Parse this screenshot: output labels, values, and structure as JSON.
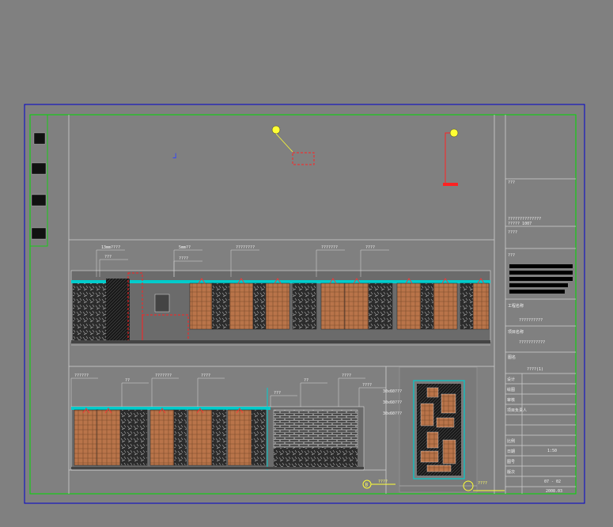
{
  "drawing": {
    "top_note": "ᒧ",
    "titleblock": {
      "t1": "???",
      "t2": "??????????????",
      "t3": "????? 1007",
      "t4": "????",
      "label_owner": "工程名称",
      "owner_value": "??????????",
      "label_project": "项目名称",
      "project_value": "???????????",
      "label_title": "图名",
      "title_value": "????(1)",
      "rows": [
        "设计",
        "绘图",
        "审核",
        "项目负责人",
        "比例",
        "日期",
        "图号",
        "版次"
      ],
      "scale": "1:50",
      "sheet_no": "07 - 02",
      "date": "2008.03"
    },
    "elev_top_labels": [
      "13mm????",
      "???",
      "5mm??",
      "????",
      "????????",
      "???????",
      "????"
    ],
    "elev_bottom_labels": [
      "??????",
      "??",
      "???????",
      "????",
      "????",
      "??",
      "????",
      "???"
    ],
    "side_labels": [
      "30x60???",
      "30x60???",
      "30x60???"
    ],
    "markers": {
      "b_label": "B",
      "b_text": "????",
      "c_text": "????"
    }
  }
}
